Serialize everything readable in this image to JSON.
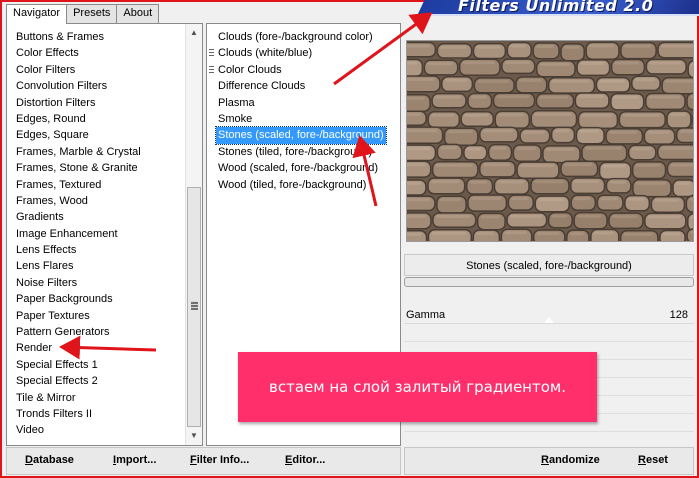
{
  "title": "Filters Unlimited 2.0",
  "tabs": [
    {
      "label": "Navigator",
      "active": true
    },
    {
      "label": "Presets",
      "active": false
    },
    {
      "label": "About",
      "active": false
    }
  ],
  "categories": [
    "Buttons & Frames",
    "Color Effects",
    "Color Filters",
    "Convolution Filters",
    "Distortion Filters",
    "Edges, Round",
    "Edges, Square",
    "Frames, Marble & Crystal",
    "Frames, Stone & Granite",
    "Frames, Textured",
    "Frames, Wood",
    "Gradients",
    "Image Enhancement",
    "Lens Effects",
    "Lens Flares",
    "Noise Filters",
    "Paper Backgrounds",
    "Paper Textures",
    "Pattern Generators",
    "Render",
    "Special Effects 1",
    "Special Effects 2",
    "Tile & Mirror",
    "Tronds Filters II",
    "Video"
  ],
  "filters": [
    "Clouds (fore-/background color)",
    "Clouds (white/blue)",
    "Color Clouds",
    "Difference Clouds",
    "Plasma",
    "Smoke",
    "Stones (scaled, fore-/background)",
    "Stones (tiled, fore-/background)",
    "Wood (scaled, fore-/background)",
    "Wood (tiled, fore-/background)"
  ],
  "selected_filter_index": 6,
  "preview": {
    "filter_name": "Stones (scaled, fore-/background)",
    "param_label": "Gamma",
    "param_value": "128"
  },
  "callout": "встаем на слой залитый градиентом.",
  "buttons": {
    "database": {
      "u": "D",
      "rest": "atabase"
    },
    "import": {
      "u": "I",
      "rest": "mport..."
    },
    "filter_info": {
      "u": "F",
      "rest": "ilter Info..."
    },
    "editor": {
      "u": "E",
      "rest": "ditor..."
    },
    "randomize": {
      "u": "R",
      "rest": "andomize"
    },
    "reset": {
      "u": "R",
      "rest": "eset"
    }
  },
  "colors": {
    "accent_red": "#e0141b",
    "selection": "#3399ff",
    "callout": "#ff2f6b"
  }
}
